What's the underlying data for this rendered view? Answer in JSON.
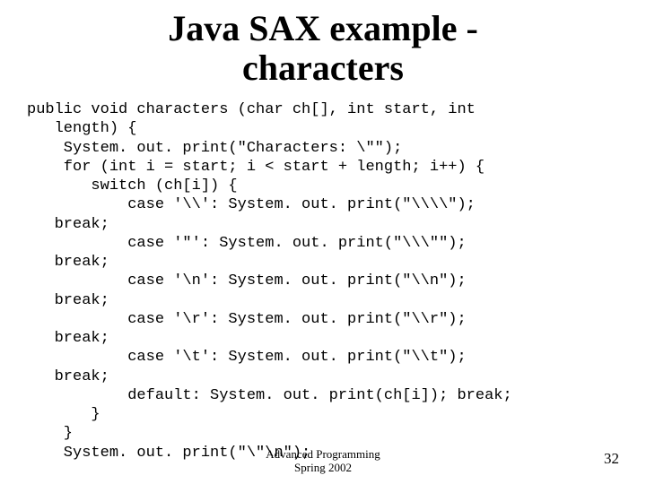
{
  "title_line1": "Java SAX example -",
  "title_line2": "characters",
  "code": {
    "l1": "public void characters (char ch[], int start, int",
    "l2": "   length) {",
    "l3": "    System. out. print(\"Characters: \\\"\");",
    "l4": "    for (int i = start; i < start + length; i++) {",
    "l5": "       switch (ch[i]) {",
    "l6": "           case '\\\\': System. out. print(\"\\\\\\\\\");",
    "l7": "   break;",
    "l8": "           case '\"': System. out. print(\"\\\\\\\"\");",
    "l9": "   break;",
    "l10": "           case '\\n': System. out. print(\"\\\\n\");",
    "l11": "   break;",
    "l12": "           case '\\r': System. out. print(\"\\\\r\");",
    "l13": "   break;",
    "l14": "           case '\\t': System. out. print(\"\\\\t\");",
    "l15": "   break;",
    "l16": "           default: System. out. print(ch[i]); break;",
    "l17": "       }",
    "l18": "    }",
    "l19": "    System. out. print(\"\\\"\\n\");"
  },
  "footer": {
    "line1": "Advanced Programming",
    "line2": "Spring 2002"
  },
  "page_number": "32"
}
